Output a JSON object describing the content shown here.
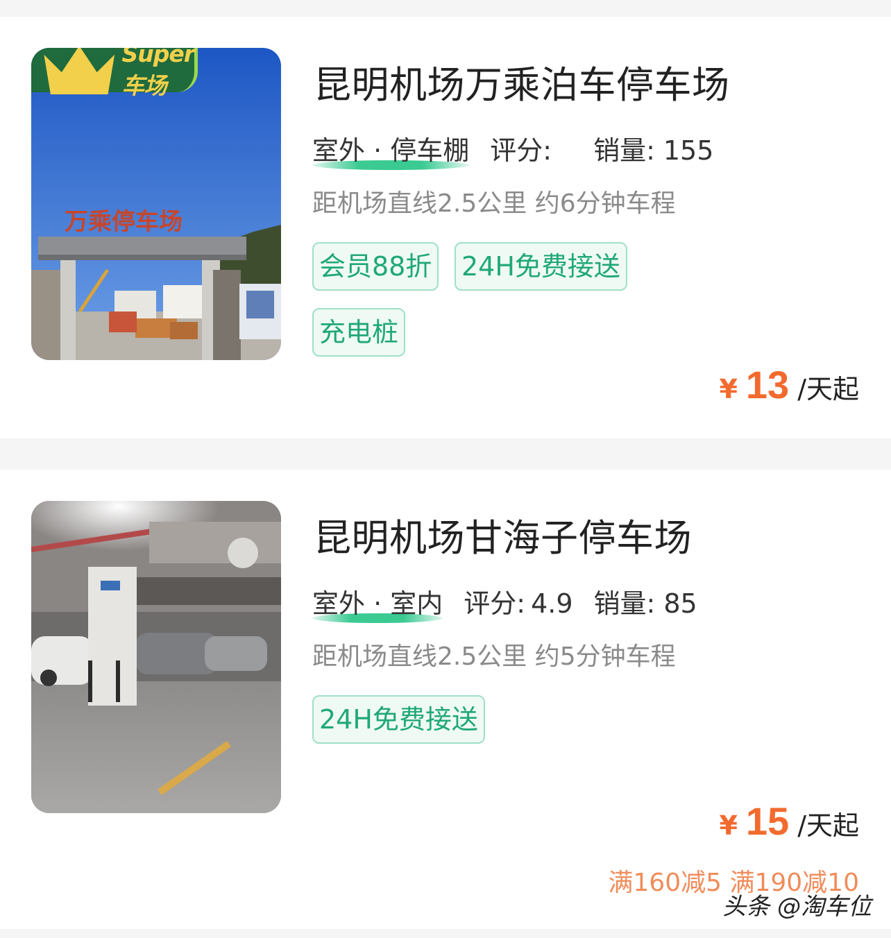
{
  "colors": {
    "accent_green": "#20a877",
    "tag_border": "#9fe0c6",
    "price_orange": "#f26a2e",
    "promo_orange": "#f08c5a",
    "badge_green": "#1f6b3d",
    "badge_gold": "#f2d04c"
  },
  "listings": [
    {
      "badge": "Super车场",
      "photo_sign": "万乘停车场",
      "title": "昆明机场万乘泊车停车场",
      "env": "室外 · 停车棚",
      "rating_label": "评分:",
      "rating_value": "",
      "sales_label": "销量:",
      "sales_value": "155",
      "distance": "距机场直线2.5公里 约6分钟车程",
      "tags": [
        "会员88折",
        "24H免费接送",
        "充电桩"
      ],
      "price_symbol": "¥",
      "price": "13",
      "price_unit": "/天起",
      "promo": ""
    },
    {
      "title": "昆明机场甘海子停车场",
      "env": "室外 · 室内",
      "rating_label": "评分:",
      "rating_value": "4.9",
      "sales_label": "销量:",
      "sales_value": "85",
      "distance": "距机场直线2.5公里 约5分钟车程",
      "tags": [
        "24H免费接送"
      ],
      "price_symbol": "¥",
      "price": "15",
      "price_unit": "/天起",
      "promo": "满160减5 满190减10"
    }
  ],
  "watermark": "头条 @淘车位"
}
